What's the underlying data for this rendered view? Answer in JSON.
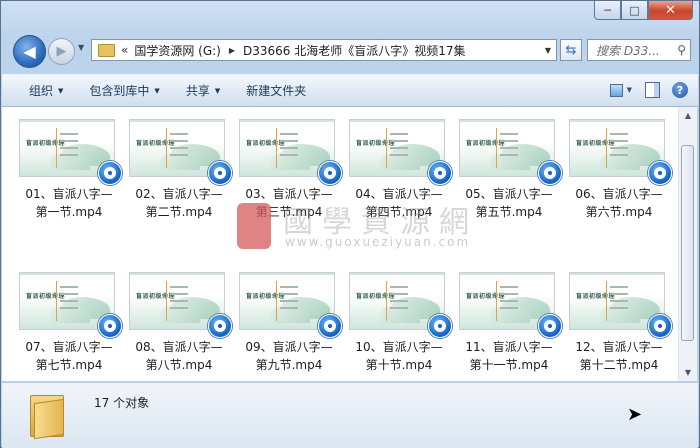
{
  "window": {
    "caption": {
      "minimize": "─",
      "maximize": "□",
      "close": "✕"
    }
  },
  "nav": {
    "back_icon": "◀",
    "forward_icon": "▶",
    "history_icon": "▼",
    "address": {
      "overflow": "«",
      "crumbs": [
        "国学资源网 (G:)",
        "D33666 北海老师《盲派八字》视频17集"
      ],
      "separator": "▶",
      "dropdown": "▼"
    },
    "refresh_icon": "⇆",
    "search": {
      "placeholder": "搜索 D33...",
      "icon": "⚲"
    }
  },
  "toolbar": {
    "organize": "组织",
    "include": "包含到库中",
    "share": "共享",
    "new_folder": "新建文件夹",
    "dropdown": "▼",
    "help": "?"
  },
  "files": [
    {
      "line1": "01、盲派八字—",
      "line2": "第一节.mp4",
      "brand": "盲派初级命理"
    },
    {
      "line1": "02、盲派八字—",
      "line2": "第二节.mp4",
      "brand": "盲派初级命理"
    },
    {
      "line1": "03、盲派八字—",
      "line2": "第三节.mp4",
      "brand": "盲派初级命理"
    },
    {
      "line1": "04、盲派八字—",
      "line2": "第四节.mp4",
      "brand": "盲派初级命理"
    },
    {
      "line1": "05、盲派八字—",
      "line2": "第五节.mp4",
      "brand": "盲派初级命理"
    },
    {
      "line1": "06、盲派八字—",
      "line2": "第六节.mp4",
      "brand": "盲派初级命理"
    },
    {
      "line1": "07、盲派八字—",
      "line2": "第七节.mp4",
      "brand": "盲派初级命理"
    },
    {
      "line1": "08、盲派八字—",
      "line2": "第八节.mp4",
      "brand": "盲派初级命理"
    },
    {
      "line1": "09、盲派八字—",
      "line2": "第九节.mp4",
      "brand": "盲派初级命理"
    },
    {
      "line1": "10、盲派八字—",
      "line2": "第十节.mp4",
      "brand": "盲派初级命理"
    },
    {
      "line1": "11、盲派八字—",
      "line2": "第十一节.mp4",
      "brand": "盲派初级命理"
    },
    {
      "line1": "12、盲派八字—",
      "line2": "第十二节.mp4",
      "brand": "盲派初级命理"
    }
  ],
  "watermark": {
    "text": "國學資源網",
    "url": "www.guoxueziyuan.com"
  },
  "details": {
    "count": "17 个对象"
  },
  "scrollbar": {
    "up": "▲",
    "down": "▼"
  }
}
